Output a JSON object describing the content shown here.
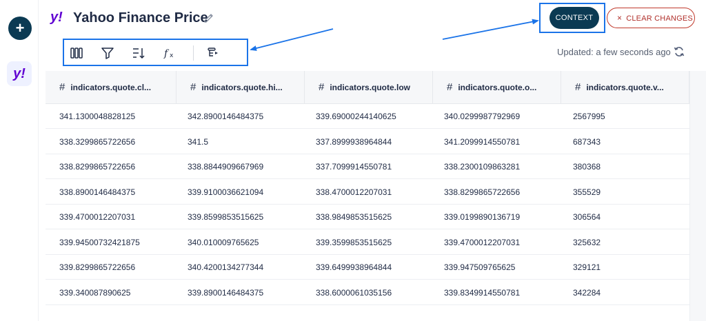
{
  "rail": {
    "add_label": "+",
    "app_logo": "y!"
  },
  "header": {
    "logo": "y!",
    "title": "Yahoo Finance Price",
    "context_label": "CONTEXT",
    "clear_label": "CLEAR CHANGES",
    "clear_icon": "×"
  },
  "toolbar": {
    "icons": [
      "columns-icon",
      "filter-icon",
      "sort-icon",
      "formula-icon",
      "group-icon"
    ]
  },
  "status": {
    "updated": "Updated: a few seconds ago"
  },
  "table": {
    "columns": [
      "indicators.quote.cl...",
      "indicators.quote.hi...",
      "indicators.quote.low",
      "indicators.quote.o...",
      "indicators.quote.v..."
    ],
    "rows": [
      [
        "341.1300048828125",
        "342.8900146484375",
        "339.69000244140625",
        "340.0299987792969",
        "2567995"
      ],
      [
        "338.3299865722656",
        "341.5",
        "337.8999938964844",
        "341.2099914550781",
        "687343"
      ],
      [
        "338.8299865722656",
        "338.8844909667969",
        "337.7099914550781",
        "338.2300109863281",
        "380368"
      ],
      [
        "338.8900146484375",
        "339.9100036621094",
        "338.4700012207031",
        "338.8299865722656",
        "355529"
      ],
      [
        "339.4700012207031",
        "339.8599853515625",
        "338.9849853515625",
        "339.0199890136719",
        "306564"
      ],
      [
        "339.94500732421875",
        "340.010009765625",
        "339.3599853515625",
        "339.4700012207031",
        "325632"
      ],
      [
        "339.8299865722656",
        "340.4200134277344",
        "339.6499938964844",
        "339.947509765625",
        "329121"
      ],
      [
        "339.340087890625",
        "339.8900146484375",
        "338.6000061035156",
        "339.8349914550781",
        "342284"
      ]
    ]
  },
  "colors": {
    "accent": "#0b3a53",
    "danger": "#c0392b",
    "highlight": "#1a73e8",
    "brand": "#6001d2"
  }
}
